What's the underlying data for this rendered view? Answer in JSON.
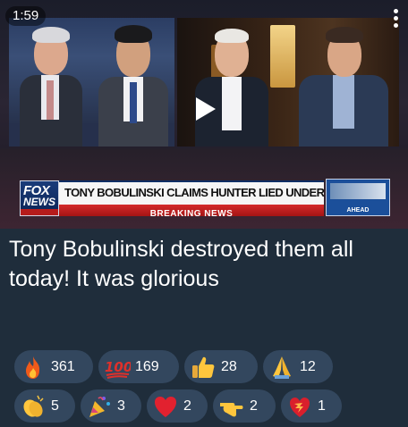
{
  "video": {
    "duration": "1:59",
    "chyron_headline": "TONY BOBULINSKI CLAIMS HUNTER LIED UNDER OATH",
    "chyron_subline": "BREAKING NEWS",
    "network_logo_top": "FOX",
    "network_logo_bottom": "NEWS",
    "ahead_label": "AHEAD"
  },
  "message": {
    "text": "Tony Bobulinski destroyed them all today! It was glorious"
  },
  "reactions": [
    {
      "icon": "fire-icon",
      "count": "361"
    },
    {
      "icon": "hundred-points-icon",
      "count": "169"
    },
    {
      "icon": "thumbs-up-icon",
      "count": "28"
    },
    {
      "icon": "folded-hands-icon",
      "count": "12"
    },
    {
      "icon": "clapping-hands-icon",
      "count": "5"
    },
    {
      "icon": "party-popper-icon",
      "count": "3"
    },
    {
      "icon": "red-heart-icon",
      "count": "2"
    },
    {
      "icon": "pointing-hand-icon",
      "count": "2"
    },
    {
      "icon": "exploding-heart-icon",
      "count": "1"
    }
  ],
  "colors": {
    "background": "#1f2d3b",
    "chip": "#33475e",
    "breaking": "#c21d1d"
  }
}
